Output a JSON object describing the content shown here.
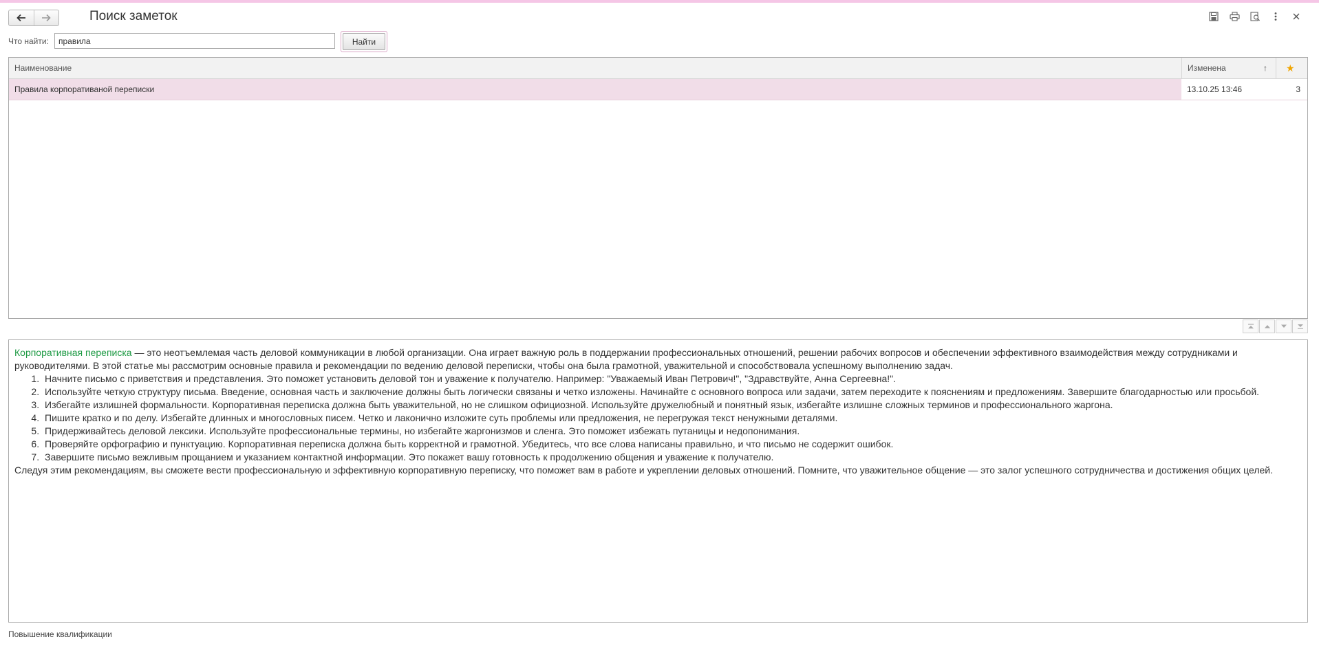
{
  "window": {
    "title": "Поиск заметок",
    "icons": [
      "back-arrow-icon",
      "forward-arrow-icon",
      "save-icon",
      "print-icon",
      "preview-icon",
      "more-icon",
      "close-icon"
    ]
  },
  "search": {
    "label": "Что найти:",
    "value": "правила",
    "button_label": "Найти"
  },
  "table": {
    "headers": {
      "name": "Наименование",
      "changed": "Изменена",
      "sort_indicator": "↑",
      "favorite": "★"
    },
    "rows": [
      {
        "name": "Правила корпоративаной переписки",
        "changed": "13.10.25 13:46",
        "count": "3"
      }
    ]
  },
  "content": {
    "highlight": "Корпоративная переписка",
    "intro": " — это неотъемлемая часть деловой коммуникации в любой организации. Она играет важную роль в поддержании профессиональных отношений, решении рабочих вопросов и обеспечении эффективного взаимодействия между сотрудниками и руководителями. В этой статье мы рассмотрим основные правила и рекомендации по ведению деловой переписки, чтобы она была грамотной, уважительной и способствовала успешному выполнению задач.",
    "items": [
      "Начните письмо с приветствия и представления. Это поможет установить деловой тон и уважение к получателю. Например: \"Уважаемый Иван Петрович!\", \"Здравствуйте, Анна Сергеевна!\".",
      "Используйте четкую структуру письма. Введение, основная часть и заключение должны быть логически связаны и четко изложены. Начинайте с основного вопроса или задачи, затем переходите к пояснениям и предложениям. Завершите благодарностью или просьбой.",
      "Избегайте излишней формальности. Корпоративная переписка должна быть уважительной, но не слишком официозной. Используйте дружелюбный и понятный язык, избегайте излишне сложных терминов и профессионального жаргона.",
      "Пишите кратко и по делу. Избегайте длинных и многословных писем. Четко и лаконично изложите суть проблемы или предложения, не перегружая текст ненужными деталями.",
      "Придерживайтесь деловой лексики. Используйте профессиональные термины, но избегайте жаргонизмов и сленга. Это поможет избежать путаницы и недопонимания.",
      "Проверяйте орфографию и пунктуацию. Корпоративная переписка должна быть корректной и грамотной. Убедитесь, что все слова написаны правильно, и что письмо не содержит ошибок.",
      "Завершите письмо вежливым прощанием и указанием контактной информации. Это покажет вашу готовность к продолжению общения и уважение к получателю."
    ],
    "conclusion": "Следуя этим рекомендациям, вы сможете вести профессиональную и эффективную корпоративную переписку, что поможет вам в работе и укреплении деловых отношений. Помните, что уважительное общение — это залог успешного сотрудничества и достижения общих целей."
  },
  "footer": {
    "text": "Повышение квалификации"
  },
  "colors": {
    "accent_stripe": "#f5c6e6",
    "selected_row": "#f1dde8",
    "highlight_text": "#1e9a44",
    "star": "#f0a500"
  }
}
